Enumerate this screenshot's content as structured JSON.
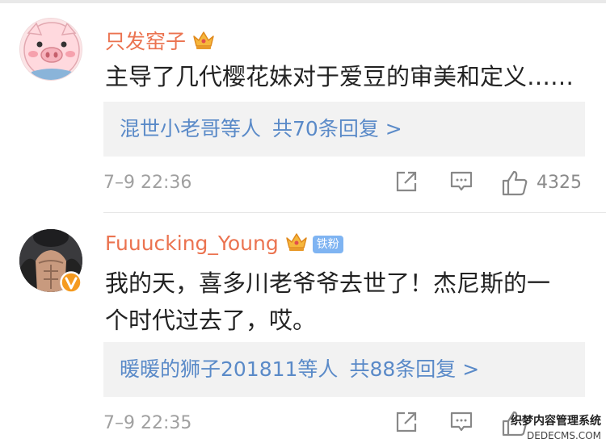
{
  "comments": [
    {
      "username": "只发窑子",
      "avatar": "pig-face-icon",
      "text": "主导了几代樱花妹对于爱豆的审美和定义……",
      "reply_users": "混世小老哥等人",
      "reply_count": "共70条回复 >",
      "time": "7–9 22:36",
      "likes": "4325"
    },
    {
      "username": "Fuuucking_Young",
      "avatar": "user-photo-avatar",
      "badge": "铁粉",
      "text_line1": "我的天，喜多川老爷爷去世了！杰尼斯的一",
      "text_line2": "个时代过去了，哎。",
      "reply_users": "暖暖的狮子201811等人",
      "reply_count": "共88条回复 >",
      "time": "7–9 22:35"
    }
  ],
  "watermark": {
    "line1": "织梦内容管理系统",
    "line2": "DEDECMS.COM"
  },
  "colors": {
    "username": "#eb7350",
    "link": "#5a8ac8",
    "meta": "#a0a0a0",
    "reply_bg": "#f2f2f2"
  }
}
